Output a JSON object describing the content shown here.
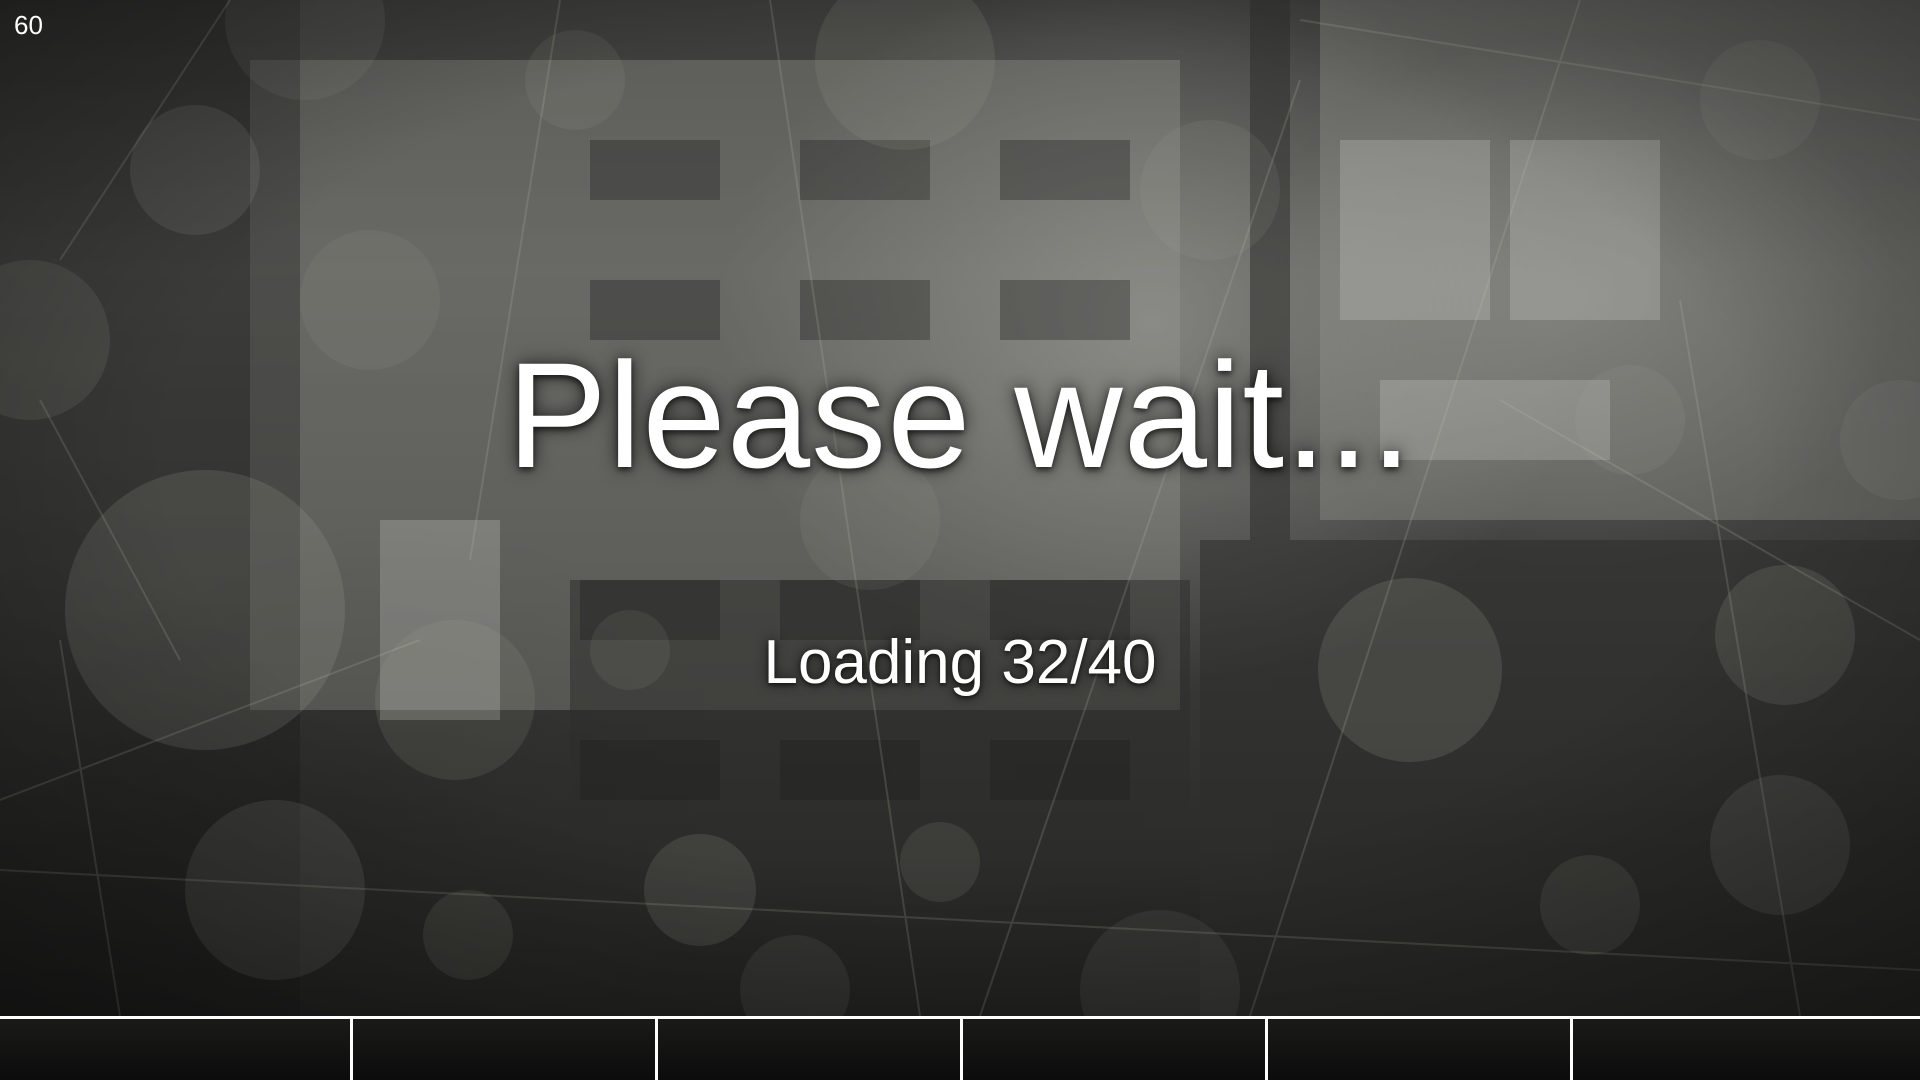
{
  "overlay": {
    "fps_counter": "60",
    "title": "Please wait...",
    "loading_text": "Loading 32/40"
  },
  "colors": {
    "text": "#ffffff",
    "background": "#3a3a38",
    "bar_background": "#0c0c0c",
    "bar_border": "#ffffff",
    "bokeh": "#b4b4a8",
    "lines": "#c8c8b4"
  },
  "background_icon": "blurred-building-photo"
}
